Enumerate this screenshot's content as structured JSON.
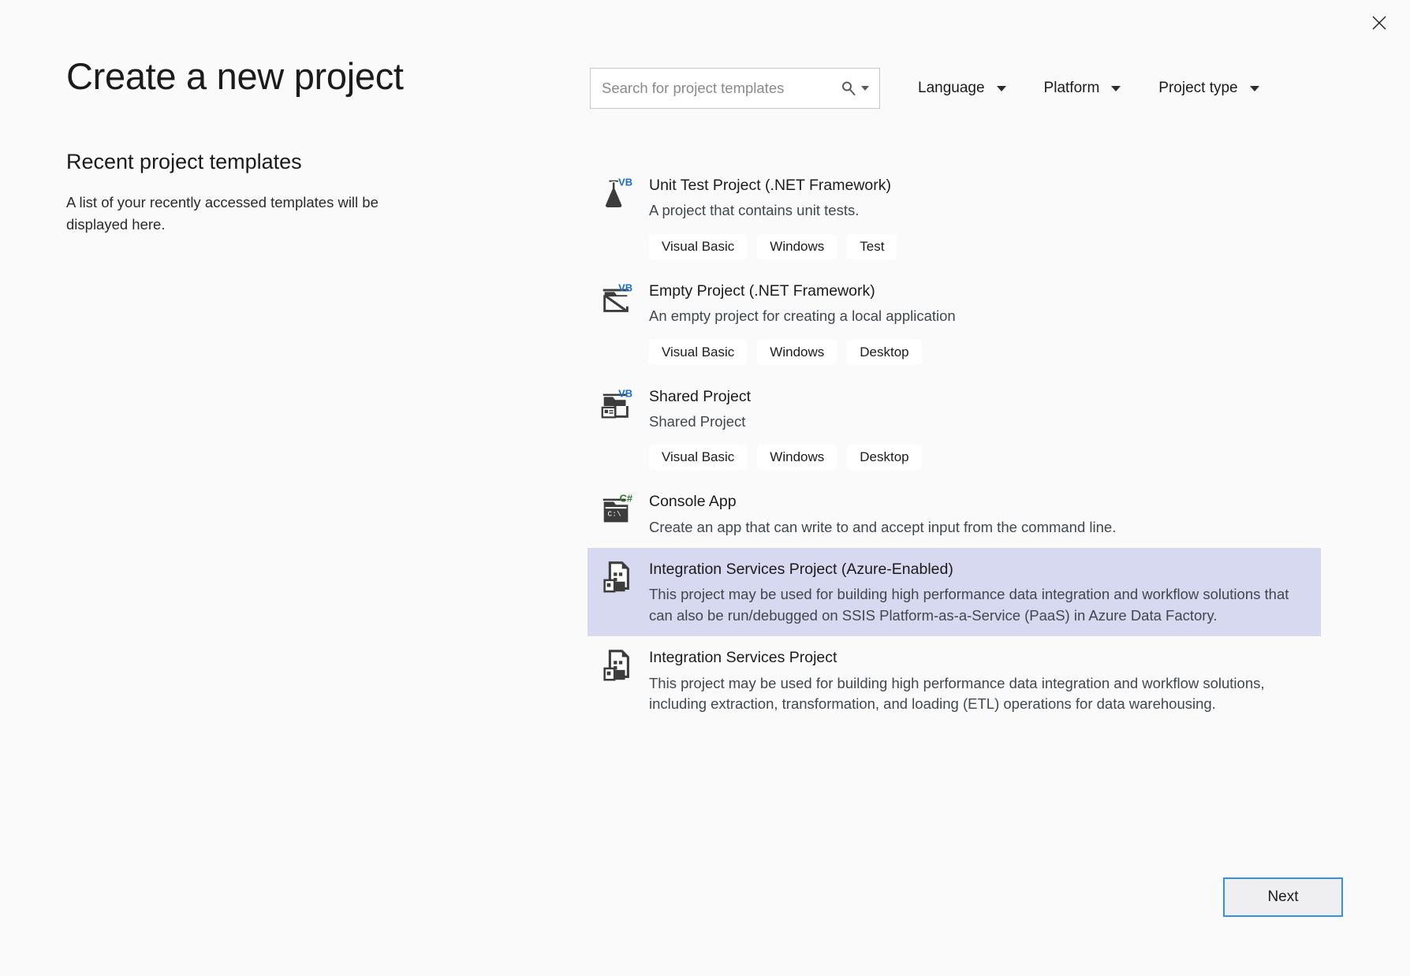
{
  "window": {
    "close_icon": "close-icon"
  },
  "left": {
    "title": "Create a new project",
    "section_title": "Recent project templates",
    "section_desc": "A list of your recently accessed templates will be displayed here."
  },
  "search": {
    "placeholder": "Search for project templates",
    "value": "",
    "icon": "search-icon",
    "caret_icon": "chevron-down-icon"
  },
  "filters": [
    {
      "label": "Language",
      "caret_icon": "chevron-down-icon"
    },
    {
      "label": "Platform",
      "caret_icon": "chevron-down-icon"
    },
    {
      "label": "Project type",
      "caret_icon": "chevron-down-icon"
    }
  ],
  "templates": [
    {
      "name": "Unit Test Project (.NET Framework)",
      "desc": "A project that contains unit tests.",
      "icon": "flask-vb-icon",
      "badge": "VB",
      "tags": [
        "Visual Basic",
        "Windows",
        "Test"
      ],
      "selected": false
    },
    {
      "name": "Empty Project (.NET Framework)",
      "desc": "An empty project for creating a local application",
      "icon": "empty-project-vb-icon",
      "badge": "VB",
      "tags": [
        "Visual Basic",
        "Windows",
        "Desktop"
      ],
      "selected": false
    },
    {
      "name": "Shared Project",
      "desc": "Shared Project",
      "icon": "shared-project-vb-icon",
      "badge": "VB",
      "tags": [
        "Visual Basic",
        "Windows",
        "Desktop"
      ],
      "selected": false
    },
    {
      "name": "Console App",
      "desc": "Create an app that can write to and accept input from the command line.",
      "icon": "console-app-csharp-icon",
      "badge": "C#",
      "tags": [],
      "selected": false
    },
    {
      "name": "Integration Services Project (Azure-Enabled)",
      "desc": "This project may be used for building high performance data integration and workflow solutions that can also be run/debugged on SSIS Platform-as-a-Service (PaaS) in Azure Data Factory.",
      "icon": "integration-services-icon",
      "badge": "",
      "tags": [],
      "selected": true
    },
    {
      "name": "Integration Services Project",
      "desc": "This project may be used for building high performance data integration and workflow solutions, including extraction, transformation, and loading (ETL) operations for data warehousing.",
      "icon": "integration-services-icon",
      "badge": "",
      "tags": [],
      "selected": false
    }
  ],
  "footer": {
    "next_label": "Next"
  },
  "colors": {
    "page_background": "#fafafa",
    "selection": "#d6d9f0",
    "accent_border": "#3390e4",
    "button_fill": "#efeff2",
    "vb_badge": "#1a6fc4",
    "csharp_badge": "#2f7a2f",
    "icon_dark": "#3c3c3c"
  }
}
